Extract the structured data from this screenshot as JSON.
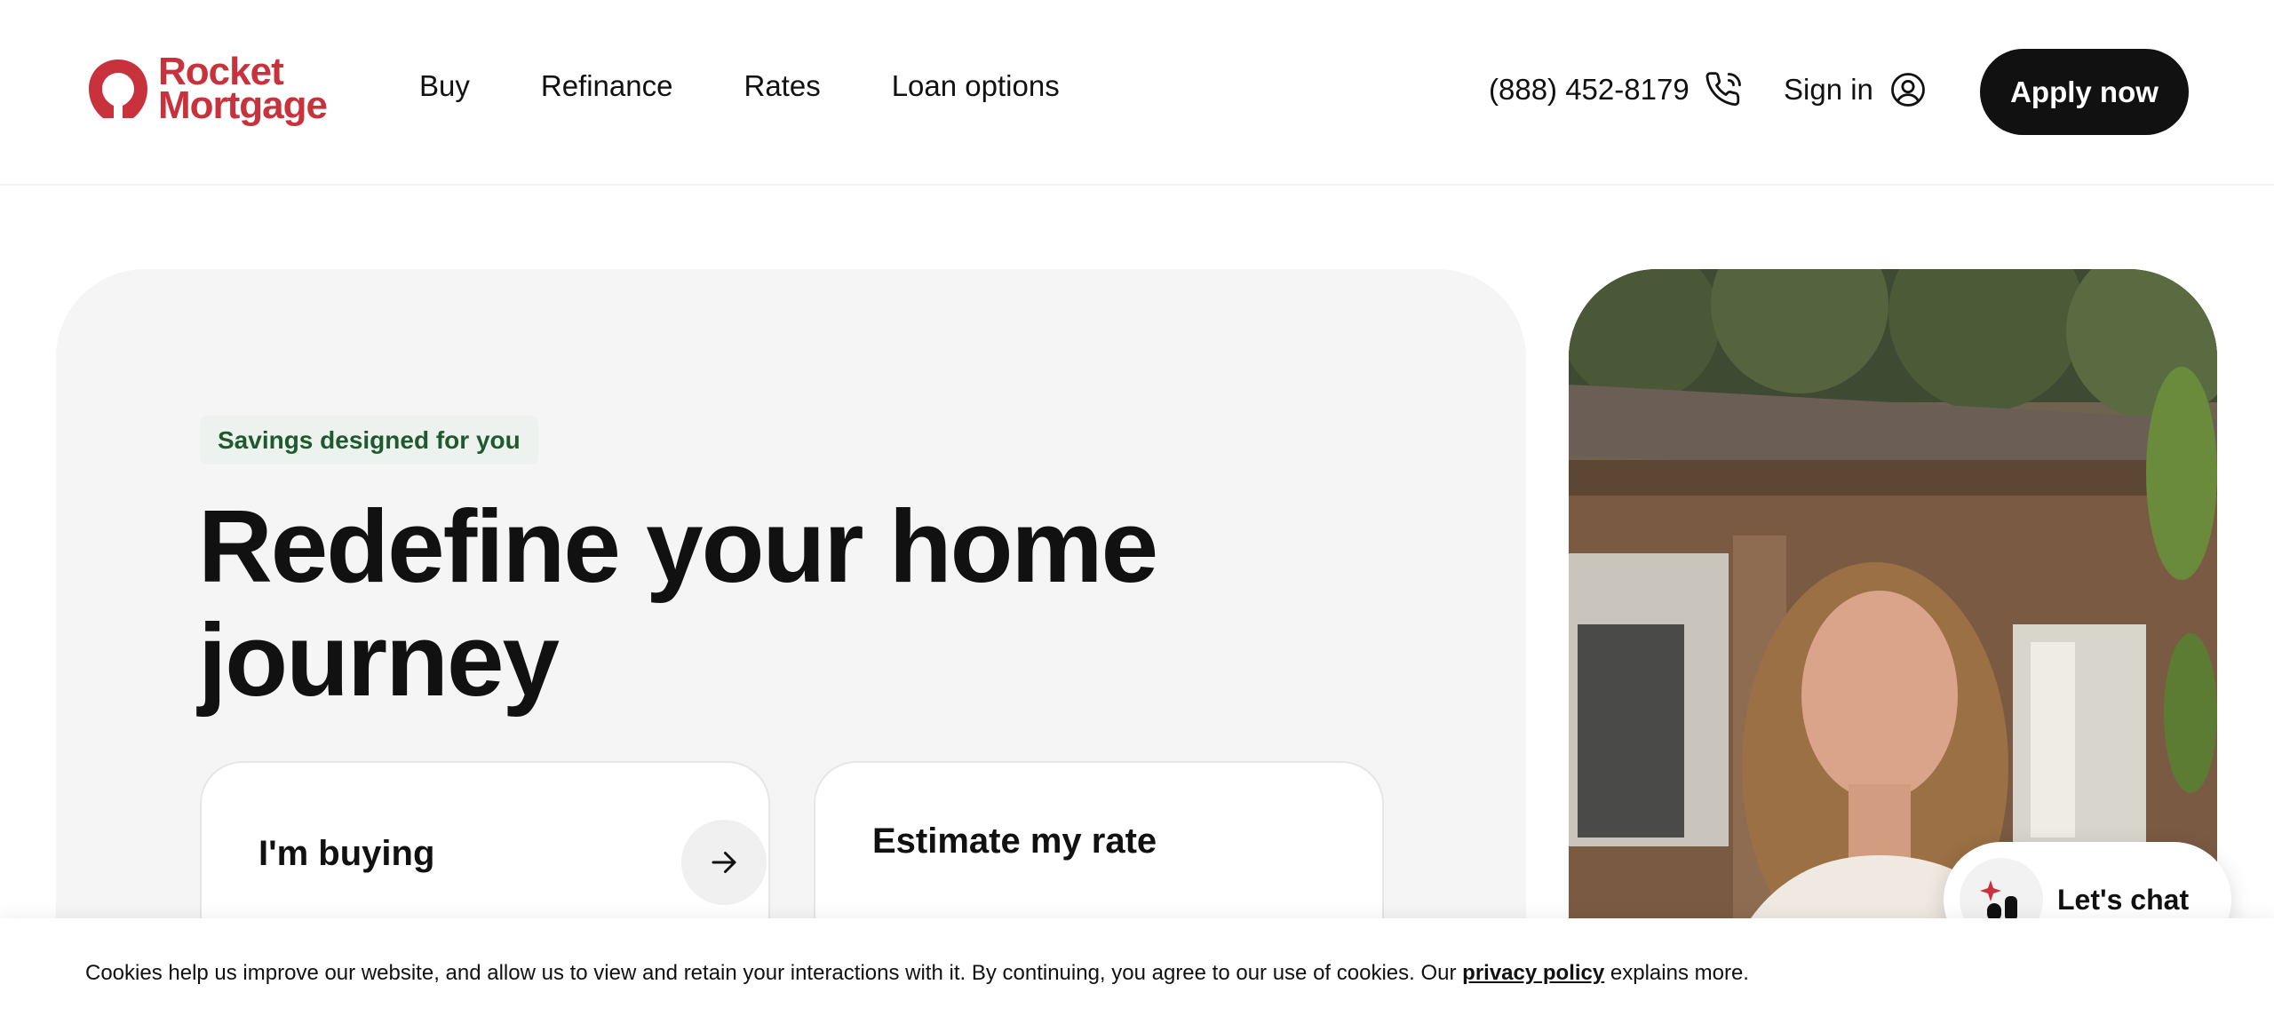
{
  "brand": {
    "name_line1": "Rocket",
    "name_line2": "Mortgage",
    "color": "#c8323c"
  },
  "nav": {
    "items": [
      {
        "label": "Buy"
      },
      {
        "label": "Refinance"
      },
      {
        "label": "Rates"
      },
      {
        "label": "Loan options"
      }
    ]
  },
  "header": {
    "phone": "(888) 452-8179",
    "phone_icon": "phone-icon",
    "signin_label": "Sign in",
    "signin_icon": "user-circle-icon",
    "apply_label": "Apply now"
  },
  "hero": {
    "badge": "Savings designed for you",
    "headline": "Redefine your home journey",
    "card1_label": "I'm buying",
    "card1_icon": "arrow-right-icon",
    "card2_label": "Estimate my rate"
  },
  "chat": {
    "label": "Let's chat",
    "icon": "chat-bot-icon"
  },
  "cookie": {
    "text_before": "Cookies help us improve our website, and allow us to view and retain your interactions with it. By continuing, you agree to our use of cookies. Our ",
    "link": "privacy policy",
    "text_after": " explains more."
  },
  "colors": {
    "accent": "#c8323c",
    "badge_text": "#1f5a2e",
    "hero_bg": "#f5f5f5",
    "button_dark": "#111111"
  }
}
